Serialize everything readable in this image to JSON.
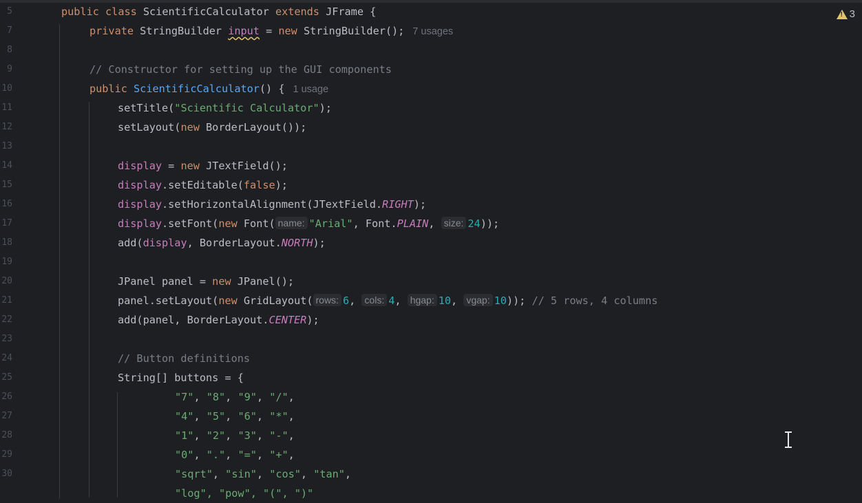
{
  "editor": {
    "warnings": {
      "count": "3",
      "icon": "warning-triangle-icon"
    },
    "hints": {
      "usages_7": "7 usages",
      "usage_1": "1 usage",
      "name": "name:",
      "size": "size:",
      "rows": "rows:",
      "cols": "cols:",
      "hgap": "hgap:",
      "vgap": "vgap:"
    },
    "line_numbers": [
      "5",
      "7",
      "8",
      "9",
      "10",
      "11",
      "12",
      "13",
      "14",
      "15",
      "16",
      "17",
      "18",
      "19",
      "20",
      "21",
      "22",
      "23",
      "24",
      "25",
      "26",
      "27",
      "28",
      "29",
      "30"
    ],
    "code": {
      "l5_kw1": "public",
      "l5_kw2": "class",
      "l5_name": "ScientificCalculator",
      "l5_kw3": "extends",
      "l5_rest": "JFrame {",
      "l7_kw": "private",
      "l7_type": "StringBuilder",
      "l7_field": "input",
      "l7_eq": "=",
      "l7_new": "new",
      "l7_rest": "StringBuilder();",
      "l9_comment": "// Constructor for setting up the GUI components",
      "l10_kw": "public",
      "l10_fn": "ScientificCalculator",
      "l10_rest": "() {",
      "l11_a": "setTitle(",
      "l11_str": "\"Scientific Calculator\"",
      "l11_b": ");",
      "l12_a": "setLayout(",
      "l12_new": "new",
      "l12_b": "BorderLayout());",
      "l14_fld": "display",
      "l14_a": "=",
      "l14_new": "new",
      "l14_b": "JTextField();",
      "l15_fld": "display",
      "l15_a": ".setEditable(",
      "l15_kw": "false",
      "l15_b": ");",
      "l16_fld": "display",
      "l16_a": ".setHorizontalAlignment(JTextField.",
      "l16_const": "RIGHT",
      "l16_b": ");",
      "l17_fld": "display",
      "l17_a": ".setFont(",
      "l17_new": "new",
      "l17_b": "Font(",
      "l17_str": "\"Arial\"",
      "l17_c": ", Font.",
      "l17_const": "PLAIN",
      "l17_d": ",",
      "l17_num": "24",
      "l17_e": "));",
      "l18_a": "add(",
      "l18_fld": "display",
      "l18_b": ", BorderLayout.",
      "l18_const": "NORTH",
      "l18_c": ");",
      "l20_a": "JPanel panel =",
      "l20_new": "new",
      "l20_b": "JPanel();",
      "l21_a": "panel.setLayout(",
      "l21_new": "new",
      "l21_b": "GridLayout(",
      "l21_n1": "6",
      "l21_c1": ",",
      "l21_n2": "4",
      "l21_c2": ",",
      "l21_n3": "10",
      "l21_c3": ",",
      "l21_n4": "10",
      "l21_c4": "));",
      "l21_comment": "// 5 rows, 4 columns",
      "l22_a": "add(panel, BorderLayout.",
      "l22_const": "CENTER",
      "l22_b": ");",
      "l24_comment": "// Button definitions",
      "l25_a": "String[] buttons = {",
      "l26": [
        "\"7\"",
        "\"8\"",
        "\"9\"",
        "\"/\""
      ],
      "l27": [
        "\"4\"",
        "\"5\"",
        "\"6\"",
        "\"*\""
      ],
      "l28": [
        "\"1\"",
        "\"2\"",
        "\"3\"",
        "\"-\""
      ],
      "l29": [
        "\"0\"",
        "\".\"",
        "\"=\"",
        "\"+\""
      ],
      "l30": [
        "\"sqrt\"",
        "\"sin\"",
        "\"cos\"",
        "\"tan\""
      ],
      "l31_partial": "\"log\", \"pow\", \"(\", \")\""
    }
  }
}
